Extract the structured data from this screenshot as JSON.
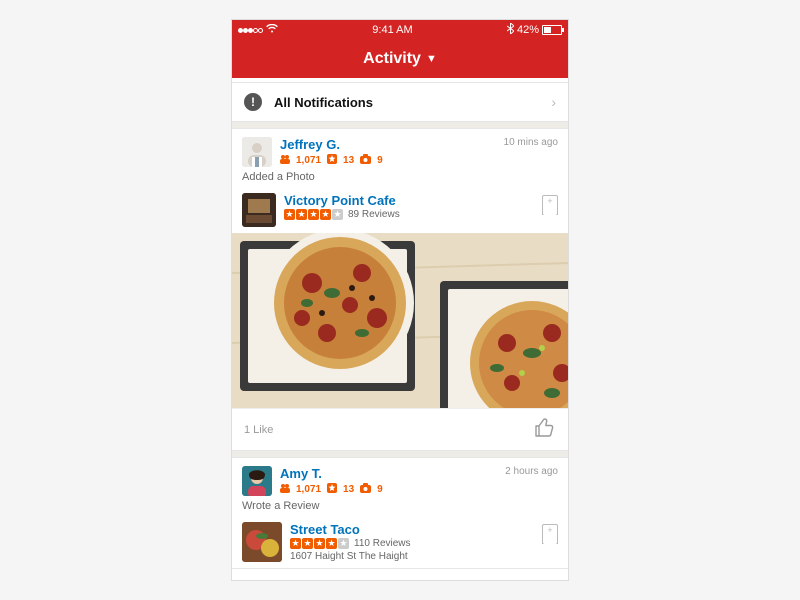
{
  "status": {
    "time": "9:41 AM",
    "battery": "42%"
  },
  "nav": {
    "title": "Activity"
  },
  "notifications": {
    "label": "All Notifications"
  },
  "feed": {
    "post1": {
      "user": "Jeffrey G.",
      "friends": "1,071",
      "reviews": "13",
      "photos": "9",
      "time": "10 mins ago",
      "action": "Added a Photo",
      "biz": "Victory Point Cafe",
      "revcount": "89 Reviews",
      "likes": "1 Like"
    },
    "post2": {
      "user": "Amy T.",
      "friends": "1,071",
      "reviews": "13",
      "photos": "9",
      "time": "2 hours ago",
      "action": "Wrote a Review",
      "biz": "Street Taco",
      "revcount": "110 Reviews",
      "addr": "1607 Haight St The Haight"
    }
  }
}
